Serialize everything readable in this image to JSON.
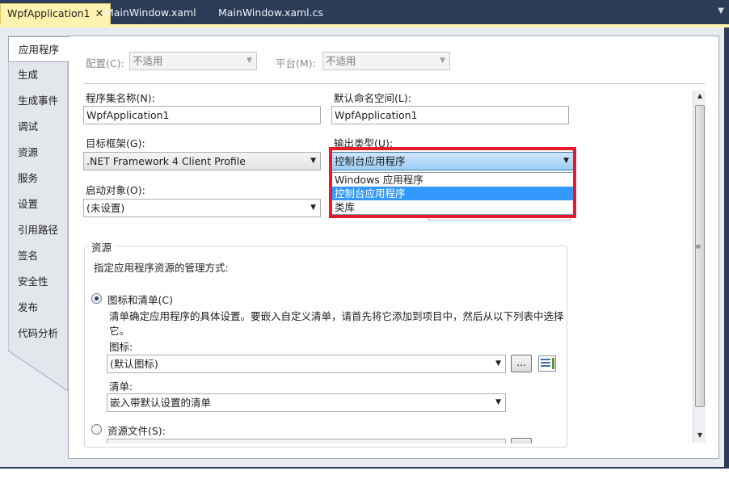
{
  "tabs": [
    {
      "label": "WpfApplication1",
      "active": true
    },
    {
      "label": "MainWindow.xaml",
      "active": false
    },
    {
      "label": "MainWindow.xaml.cs",
      "active": false
    }
  ],
  "categories": [
    "应用程序",
    "生成",
    "生成事件",
    "调试",
    "资源",
    "服务",
    "设置",
    "引用路径",
    "签名",
    "安全性",
    "发布",
    "代码分析"
  ],
  "config": {
    "config_label": "配置(C):",
    "config_value": "不适用",
    "platform_label": "平台(M):",
    "platform_value": "不适用"
  },
  "app": {
    "assembly_name_label": "程序集名称(N):",
    "assembly_name_value": "WpfApplication1",
    "default_namespace_label": "默认命名空间(L):",
    "default_namespace_value": "WpfApplication1",
    "target_framework_label": "目标框架(G):",
    "target_framework_value": ".NET Framework 4 Client Profile",
    "output_type_label": "输出类型(U):",
    "output_type_value": "控制台应用程序",
    "output_type_options": [
      "Windows 应用程序",
      "控制台应用程序",
      "类库"
    ],
    "output_type_selected_index": 1,
    "startup_object_label": "启动对象(O):",
    "startup_object_value": "(未设置)"
  },
  "resources": {
    "title": "资源",
    "description": "指定应用程序资源的管理方式:",
    "icon_manifest_label": "图标和清单(C)",
    "icon_manifest_checked": true,
    "icon_manifest_help_line1": "清单确定应用程序的具体设置。要嵌入自定义清单，请首先将它添加到项目中，然后从以下列表中选择",
    "icon_manifest_help_line2": "它。",
    "icon_label": "图标:",
    "icon_value": "(默认图标)",
    "browse_label": "...",
    "manifest_label": "清单:",
    "manifest_value": "嵌入带默认设置的清单",
    "resource_file_label": "资源文件(S):",
    "resource_file_checked": false
  },
  "colors": {
    "tabstrip": "#2b3c59",
    "active_tab": "#fff3b0",
    "selection": "#3399ff",
    "highlight_border": "#e8192c"
  }
}
